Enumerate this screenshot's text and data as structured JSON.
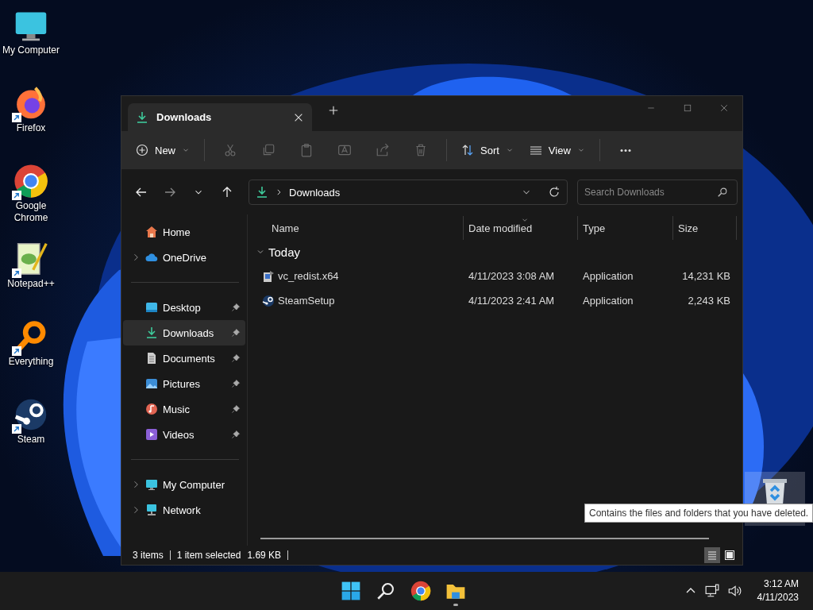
{
  "desktop_icons": [
    {
      "label": "My Computer",
      "kind": "computer",
      "shortcut": false
    },
    {
      "label": "Firefox",
      "kind": "firefox",
      "shortcut": true
    },
    {
      "label": "Google Chrome",
      "kind": "chrome",
      "shortcut": true
    },
    {
      "label": "Notepad++",
      "kind": "notepad",
      "shortcut": true
    },
    {
      "label": "Everything",
      "kind": "everything",
      "shortcut": true
    },
    {
      "label": "Steam",
      "kind": "steam",
      "shortcut": true
    }
  ],
  "recycle_bin": {
    "hovered": true,
    "tooltip": "Contains the files and folders that you have deleted."
  },
  "window": {
    "tabs": [
      {
        "label": "Downloads",
        "selected": true
      }
    ],
    "toolbar": [
      {
        "kind": "new",
        "label": "New",
        "disabled": false
      },
      {
        "kind": "cut",
        "disabled": true
      },
      {
        "kind": "copy",
        "disabled": true
      },
      {
        "kind": "paste",
        "disabled": true
      },
      {
        "kind": "rename",
        "disabled": true
      },
      {
        "kind": "share",
        "disabled": true
      },
      {
        "kind": "delete",
        "disabled": true
      },
      {
        "kind": "sort",
        "label": "Sort",
        "disabled": false
      },
      {
        "kind": "view",
        "label": "View",
        "disabled": false
      },
      {
        "kind": "more",
        "disabled": false
      }
    ],
    "address": {
      "path": "Downloads"
    },
    "search": {
      "placeholder": "Search Downloads"
    },
    "sidebar": {
      "sections": [
        [
          {
            "label": "Home",
            "kind": "home",
            "expandable": false,
            "pinned": false,
            "selected": false
          },
          {
            "label": "OneDrive",
            "kind": "cloud",
            "expandable": true,
            "pinned": false,
            "selected": false
          }
        ],
        [
          {
            "label": "Desktop",
            "kind": "desktop",
            "expandable": false,
            "pinned": true,
            "selected": false
          },
          {
            "label": "Downloads",
            "kind": "download",
            "expandable": false,
            "pinned": true,
            "selected": true
          },
          {
            "label": "Documents",
            "kind": "documents",
            "expandable": false,
            "pinned": true,
            "selected": false
          },
          {
            "label": "Pictures",
            "kind": "pictures",
            "expandable": false,
            "pinned": true,
            "selected": false
          },
          {
            "label": "Music",
            "kind": "music",
            "expandable": false,
            "pinned": true,
            "selected": false
          },
          {
            "label": "Videos",
            "kind": "videos",
            "expandable": false,
            "pinned": true,
            "selected": false
          }
        ],
        [
          {
            "label": "My Computer",
            "kind": "computer",
            "expandable": true,
            "pinned": false,
            "selected": false
          },
          {
            "label": "Network",
            "kind": "network",
            "expandable": true,
            "pinned": false,
            "selected": false
          }
        ]
      ]
    },
    "table": {
      "columns": [
        {
          "label": "Name",
          "sorted": false
        },
        {
          "label": "Date modified",
          "sorted": true
        },
        {
          "label": "Type",
          "sorted": false
        },
        {
          "label": "Size",
          "sorted": false
        }
      ],
      "groups": [
        {
          "label": "Today",
          "expanded": true,
          "rows": [
            {
              "kind": "installer",
              "name": "vc_redist.x64",
              "date": "4/11/2023 3:08 AM",
              "type": "Application",
              "size": "14,231 KB",
              "selected": false
            },
            {
              "kind": "steam",
              "name": "SteamSetup",
              "date": "4/11/2023 2:41 AM",
              "type": "Application",
              "size": "2,243 KB",
              "selected": false
            }
          ]
        }
      ]
    },
    "status_bar": {
      "items": "3 items",
      "selection": "1 item selected",
      "selection_size": "1.69 KB",
      "views": [
        {
          "kind": "details",
          "selected": true
        },
        {
          "kind": "tiles",
          "selected": false
        }
      ]
    }
  },
  "taskbar": {
    "apps": [
      {
        "kind": "windows",
        "running": false
      },
      {
        "kind": "search",
        "running": false
      },
      {
        "kind": "chrome",
        "running": false
      },
      {
        "kind": "folder",
        "running": true
      }
    ],
    "time": "3:12 AM",
    "date": "4/11/2023"
  }
}
